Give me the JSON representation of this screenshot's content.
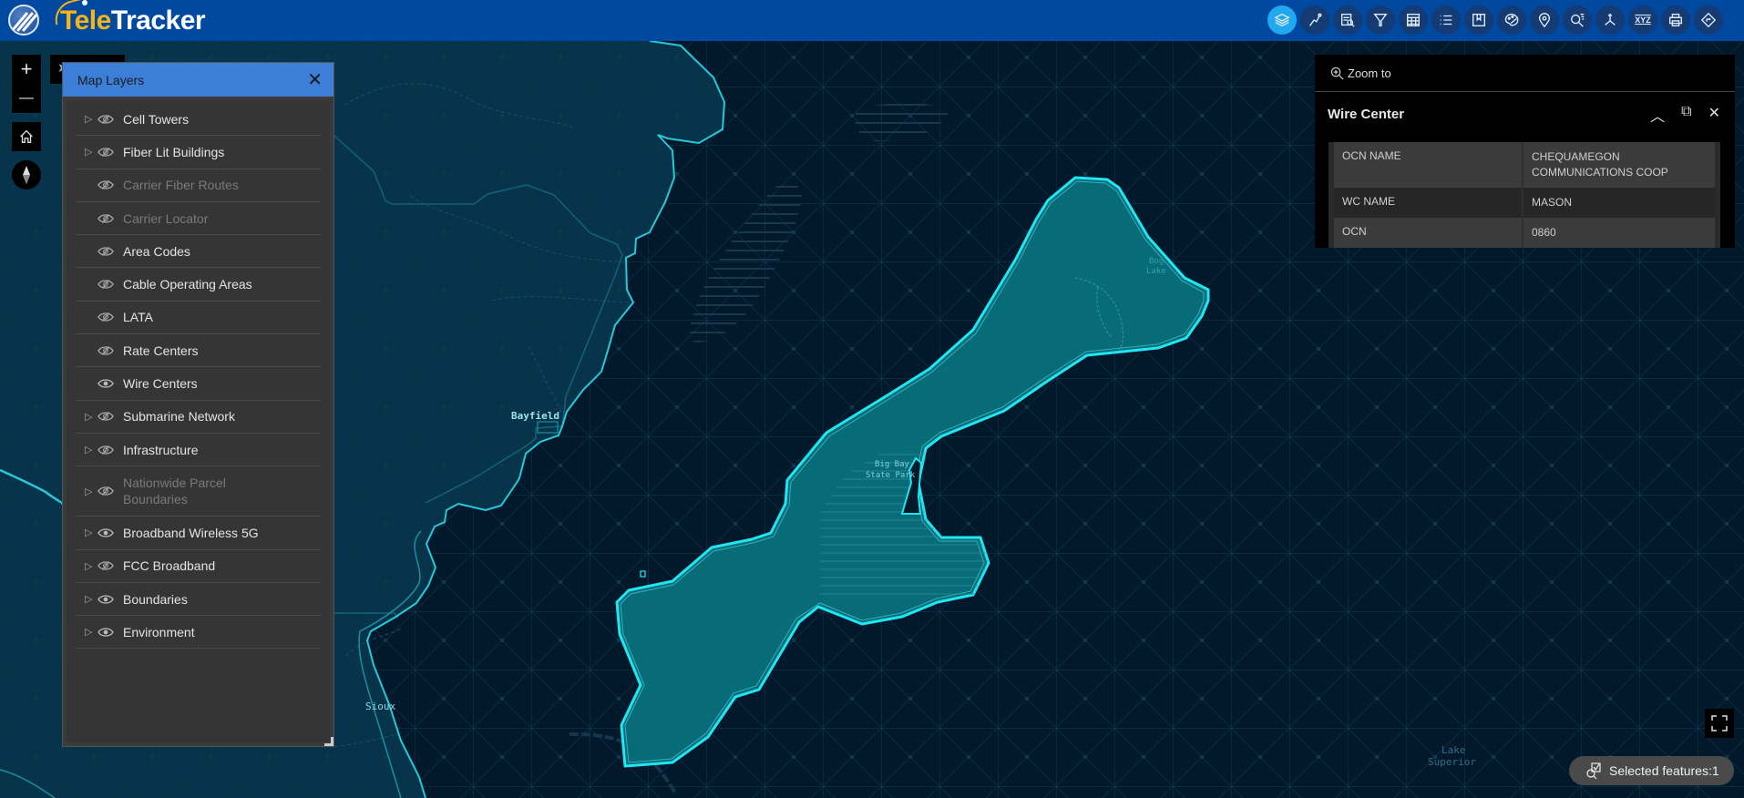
{
  "app": {
    "title_part1": "Tele",
    "title_part2": "Tracker"
  },
  "toolbar": {
    "tools": [
      {
        "name": "layers",
        "icon": "layers-icon",
        "active": true
      },
      {
        "name": "draw",
        "icon": "draw-icon",
        "active": false
      },
      {
        "name": "query",
        "icon": "query-icon",
        "active": false
      },
      {
        "name": "filter",
        "icon": "filter-icon",
        "active": false
      },
      {
        "name": "table",
        "icon": "table-icon",
        "active": false
      },
      {
        "name": "legend",
        "icon": "list-icon",
        "active": false
      },
      {
        "name": "bookmarks",
        "icon": "bookmark-icon",
        "active": false
      },
      {
        "name": "basemap",
        "icon": "palette-icon",
        "active": false
      },
      {
        "name": "locate",
        "icon": "pin-icon",
        "active": false
      },
      {
        "name": "search",
        "icon": "search-icon",
        "active": false
      },
      {
        "name": "measure",
        "icon": "axis-icon",
        "active": false
      },
      {
        "name": "coordinates",
        "icon": "xyz-icon",
        "active": false
      },
      {
        "name": "print",
        "icon": "print-icon",
        "active": false
      },
      {
        "name": "directions",
        "icon": "directions-icon",
        "active": false
      }
    ],
    "xyz_label": "XYZ"
  },
  "map_controls": {
    "zoom_in": "+",
    "zoom_out": "—"
  },
  "layers_panel": {
    "title": "Map Layers",
    "layers": [
      {
        "label": "Cell Towers",
        "expandable": true,
        "visible": false,
        "enabled": true
      },
      {
        "label": "Fiber Lit Buildings",
        "expandable": true,
        "visible": false,
        "enabled": true
      },
      {
        "label": "Carrier Fiber Routes",
        "expandable": false,
        "visible": false,
        "enabled": false
      },
      {
        "label": "Carrier Locator",
        "expandable": false,
        "visible": false,
        "enabled": false
      },
      {
        "label": "Area Codes",
        "expandable": false,
        "visible": false,
        "enabled": true
      },
      {
        "label": "Cable Operating Areas",
        "expandable": false,
        "visible": false,
        "enabled": true
      },
      {
        "label": "LATA",
        "expandable": false,
        "visible": false,
        "enabled": true
      },
      {
        "label": "Rate Centers",
        "expandable": false,
        "visible": false,
        "enabled": true
      },
      {
        "label": "Wire Centers",
        "expandable": false,
        "visible": true,
        "enabled": true
      },
      {
        "label": "Submarine Network",
        "expandable": true,
        "visible": false,
        "enabled": true
      },
      {
        "label": "Infrastructure",
        "expandable": true,
        "visible": false,
        "enabled": true
      },
      {
        "label": "Nationwide Parcel Boundaries",
        "expandable": true,
        "visible": false,
        "enabled": false
      },
      {
        "label": "Broadband Wireless 5G",
        "expandable": true,
        "visible": true,
        "enabled": true
      },
      {
        "label": "FCC Broadband",
        "expandable": true,
        "visible": false,
        "enabled": true
      },
      {
        "label": "Boundaries",
        "expandable": true,
        "visible": true,
        "enabled": true
      },
      {
        "label": "Environment",
        "expandable": true,
        "visible": true,
        "enabled": true
      }
    ]
  },
  "popup": {
    "zoom_to_label": "Zoom to",
    "title": "Wire Center",
    "fields": [
      {
        "key": "OCN NAME",
        "value": "CHEQUAMEGON COMMUNICATIONS COOP"
      },
      {
        "key": "WC NAME",
        "value": "MASON"
      },
      {
        "key": "OCN",
        "value": "0860"
      }
    ]
  },
  "map_labels": {
    "bayfield": "Bayfield",
    "sioux": "Sioux",
    "big_bay_1": "Big Bay",
    "big_bay_2": "State Park",
    "bog_1": "Bog",
    "bog_2": "Lake",
    "lake_1": "Lake",
    "lake_2": "Superior"
  },
  "status": {
    "selected_features_label": "Selected features:1"
  },
  "colors": {
    "header_bg": "#0049a0",
    "active_tool": "#21a9f0",
    "panel_header": "#3d7fd8",
    "selection_outline": "#1fe6f0",
    "selection_fill": "#0a6a76",
    "water": "#02182b",
    "land": "#06344a"
  }
}
